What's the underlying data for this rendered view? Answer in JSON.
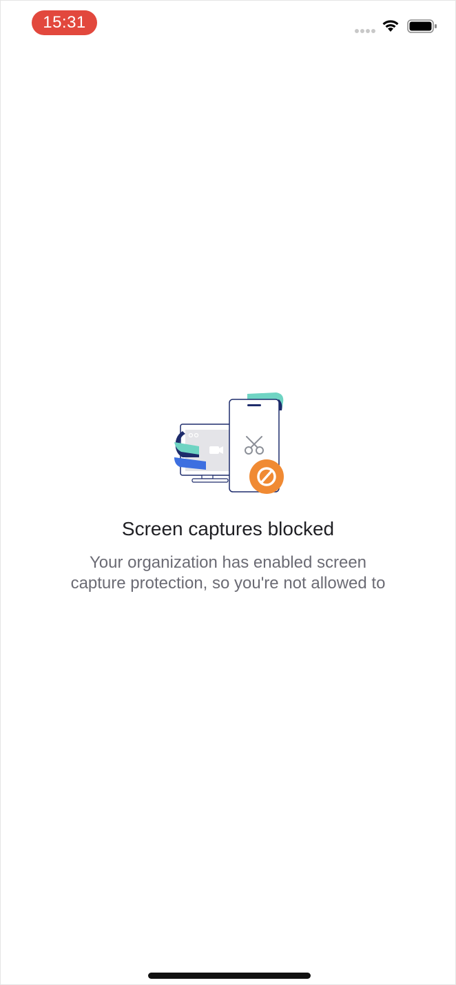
{
  "status_bar": {
    "time": "15:31",
    "signal_icon": "cellular-signal-icon",
    "wifi_icon": "wifi-icon",
    "battery_icon": "battery-icon",
    "time_pill_color": "#e2483d"
  },
  "main": {
    "illustration_icon": "screen-capture-blocked-illustration",
    "title": "Screen captures blocked",
    "message_lines": [
      "Your organization has enabled screen",
      "capture protection, so you're not allowed to"
    ]
  },
  "colors": {
    "accent_orange": "#f08a33",
    "accent_teal": "#6fd4c3",
    "accent_navy": "#1d2b6b",
    "accent_blue": "#3d6fe0"
  }
}
